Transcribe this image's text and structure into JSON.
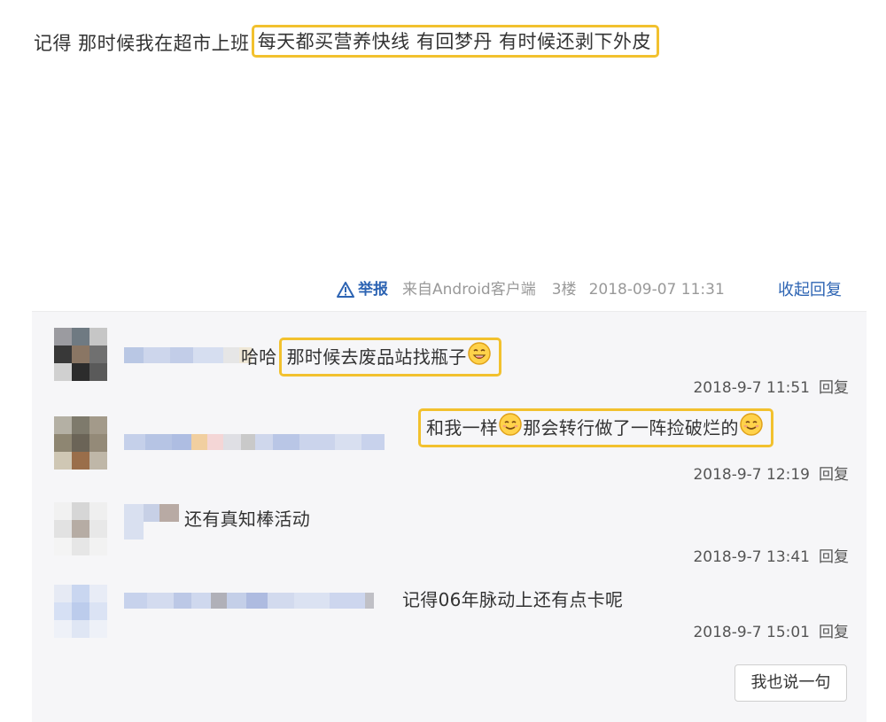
{
  "post": {
    "prefix": "记得 那时候我在超市上班",
    "highlight": "每天都买营养快线 有回梦丹 有时候还剥下外皮"
  },
  "meta": {
    "report_label": "举报",
    "source": "来自Android客户端",
    "floor": "3楼",
    "time": "2018-09-07 11:31",
    "collapse_label": "收起回复"
  },
  "replies": [
    {
      "prefix": "哈哈",
      "highlight": "那时候去废品站找瓶子",
      "time": "2018-9-7 11:51",
      "reply_label": "回复"
    },
    {
      "prefix": "和我一样",
      "middle": "那会转行做了一阵捡破烂的",
      "time": "2018-9-7 12:19",
      "reply_label": "回复"
    },
    {
      "text": "还有真知棒活动",
      "time": "2018-9-7 13:41",
      "reply_label": "回复"
    },
    {
      "text": "记得06年脉动上还有点卡呢",
      "time": "2018-9-7 15:01",
      "reply_label": "回复"
    }
  ],
  "say_button_label": "我也说一句",
  "colors": {
    "highlight_border": "#f2c12e",
    "link_blue": "#2d64b3",
    "reply_bg": "#f6f6f8"
  }
}
